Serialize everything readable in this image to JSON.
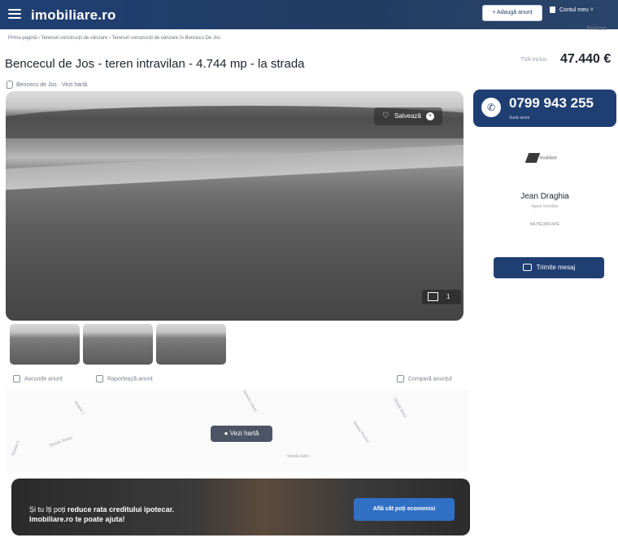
{
  "header": {
    "logo": "imobiliare.ro",
    "add_button": "+ Adaugă anunț",
    "account": "Contul meu ˅"
  },
  "breadcrumb": "Prima pagină  ›  Terenuri construcții de vânzare  ›  Terenuri construcții de vânzare în Bencecu De Jos",
  "print": "Printare",
  "listing": {
    "title": "Bencecul de Jos - teren intravilan - 4.744 mp - la strada",
    "price_label": "TVA inclus",
    "price": "47.440 €",
    "location": "Bencecu de Jos · Vezi hartă"
  },
  "photo": {
    "save_label": "Salvează",
    "photo_count": "1"
  },
  "actions": {
    "hide": "Ascunde anunț",
    "report": "Raportează anunț",
    "compare": "Compară anunțul"
  },
  "map": {
    "button": "Vezi hartă",
    "streets": [
      "Strada 1",
      "Strada Teiului",
      "Strada Livezii",
      "Strada Florilor",
      "Strada Morii",
      "Strada 2",
      "Strada Gării"
    ]
  },
  "banner": {
    "text_prefix": "Și tu îți poți ",
    "text_bold": "reduce rata creditului ipotecar.",
    "text_line2": "Imobiliare.ro te poate ajuta!",
    "cta": "Află cât poți economisi"
  },
  "agent": {
    "phone": "0799 943 255",
    "phone_sub": "Sună acum",
    "agency": "Imobiliare",
    "name": "Jean Draghia",
    "role": "Agent imobiliar",
    "code": "BA75E38814PE",
    "message_button": "Trimite mesaj"
  }
}
